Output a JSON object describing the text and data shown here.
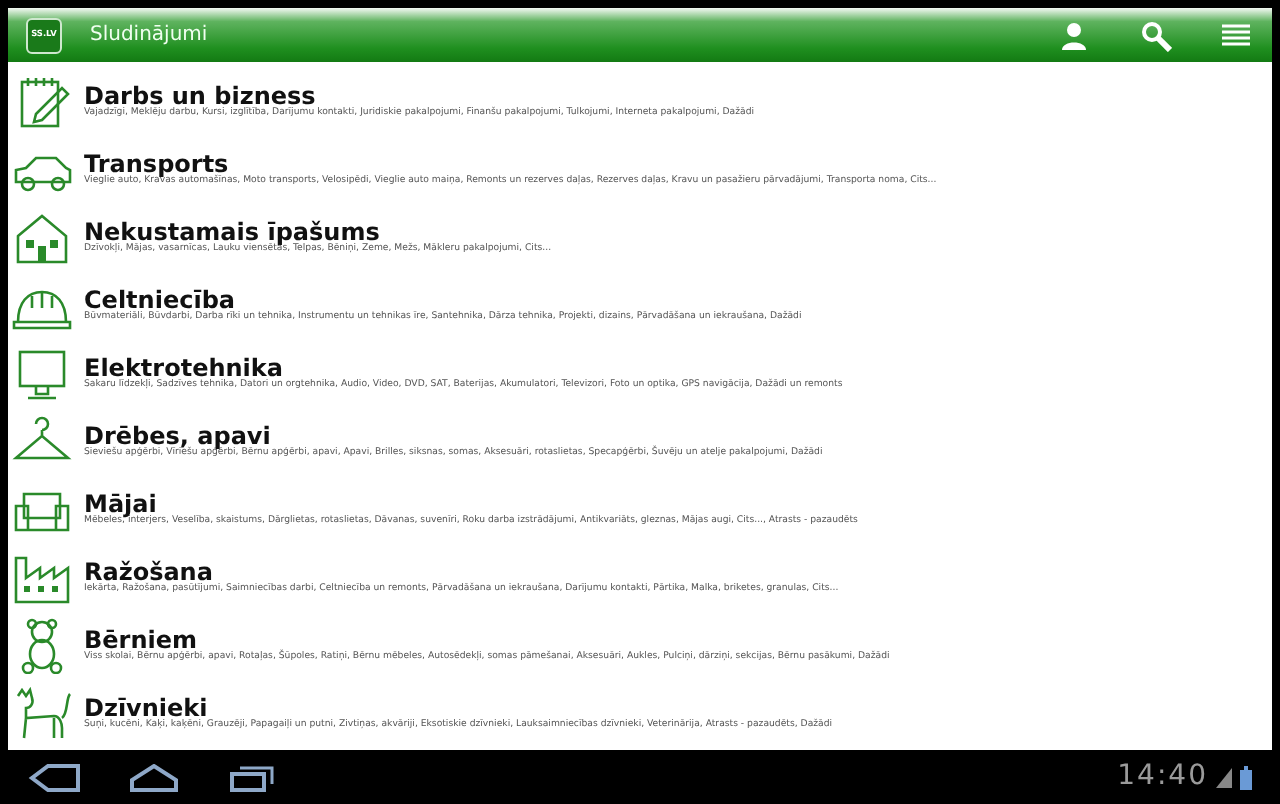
{
  "app_bar": {
    "logo": "SS.LV",
    "title": "Sludinājumi"
  },
  "categories": [
    {
      "kind": "notepad",
      "title": "Darbs un bizness",
      "subtitle": "Vajadzīgi, Meklēju darbu, Kursi, izglītība, Darījumu kontakti, Juridiskie pakalpojumi, Finanšu pakalpojumi, Tulkojumi, Interneta pakalpojumi, Dažādi"
    },
    {
      "kind": "car",
      "title": "Transports",
      "subtitle": "Vieglie auto, Kravas automašīnas, Moto transports, Velosipēdi, Vieglie auto maiņa, Remonts un rezerves daļas, Rezerves daļas, Kravu un pasažieru pārvadājumi, Transporta noma, Cits..."
    },
    {
      "kind": "house",
      "title": "Nekustamais īpašums",
      "subtitle": "Dzīvokļi, Mājas, vasarnīcas, Lauku viensētas, Telpas, Bēniņi, Zeme, Mežs, Mākleru pakalpojumi, Cits..."
    },
    {
      "kind": "helmet",
      "title": "Celtniecība",
      "subtitle": "Būvmateriāli, Būvdarbi, Darba rīki un tehnika, Instrumentu un tehnikas īre, Santehnika, Dārza tehnika, Projekti, dizains, Pārvadāšana un iekraušana, Dažādi"
    },
    {
      "kind": "monitor",
      "title": "Elektrotehnika",
      "subtitle": "Sakaru līdzekļi, Sadzīves tehnika, Datori un orgtehnika, Audio, Video, DVD, SAT, Baterijas, Akumulatori, Televizori, Foto un optika, GPS navigācija, Dažādi un remonts"
    },
    {
      "kind": "hanger",
      "title": "Drēbes, apavi",
      "subtitle": "Sieviešu apģērbi, Vīriešu apģērbi, Bērnu apģērbi, apavi, Apavi, Brilles, siksnas, somas, Aksesuāri, rotaslietas, Specapģērbi, Šuvēju un atelje pakalpojumi, Dažādi"
    },
    {
      "kind": "armchair",
      "title": "Mājai",
      "subtitle": "Mēbeles, interjers, Veselība, skaistums, Dārglietas, rotaslietas, Dāvanas, suvenīri, Roku darba izstrādājumi, Antikvariāts, gleznas, Mājas augi, Cits..., Atrasts - pazaudēts"
    },
    {
      "kind": "factory",
      "title": "Ražošana",
      "subtitle": "Iekārta, Ražošana, pasūtījumi, Saimniecības darbi, Celtniecība un remonts, Pārvadāšana un iekraušana, Darījumu kontakti, Pārtika, Malka, briketes, granulas, Cits..."
    },
    {
      "kind": "teddy",
      "title": "Bērniem",
      "subtitle": "Viss skolai, Bērnu apģērbi, apavi, Rotaļas, Šūpoles, Ratiņi, Bērnu mēbeles, Autosēdekļi, somas pāmešanai, Aksesuāri, Aukles, Pulciņi, dārziņi, sekcijas, Bērnu pasākumi, Dažādi"
    },
    {
      "kind": "cat",
      "title": "Dzīvnieki",
      "subtitle": "Suņi, kucēni, Kaķi, kaķēni, Grauzēji, Papagaiļi un putni, Zivtiņas, akvāriji, Eksotiskie dzīvnieki, Lauksaimniecības dzīvnieki, Veterinārija, Atrasts - pazaudēts, Dažādi"
    }
  ],
  "system_bar": {
    "time": "14:40"
  }
}
